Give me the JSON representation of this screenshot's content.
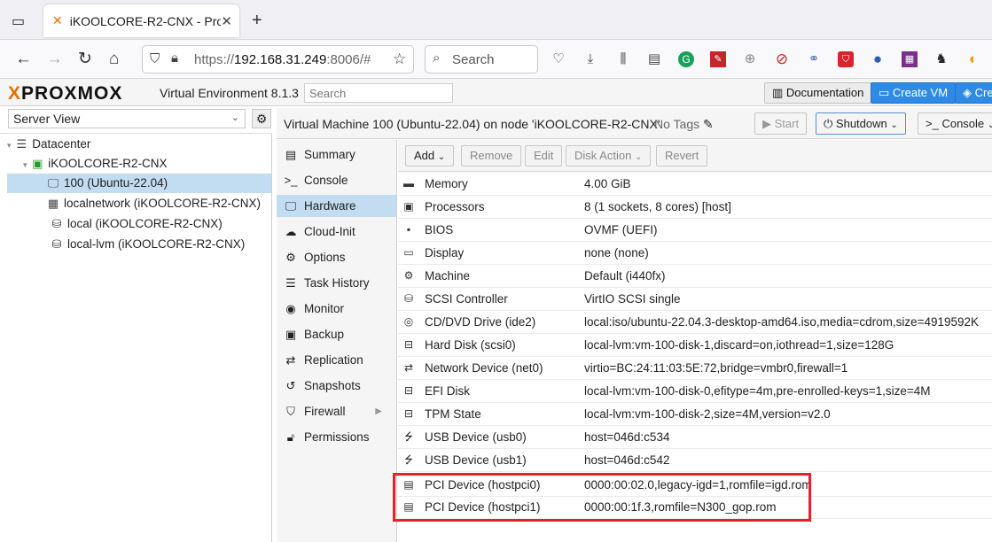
{
  "browser": {
    "tab_title": "iKOOLCORE-R2-CNX - Pro",
    "tab_close": "✕",
    "new_tab": "+",
    "url_scheme": "https://",
    "url_host": "192.168.31.249",
    "url_rest": ":8006/#",
    "search_placeholder": "Search"
  },
  "header": {
    "logo_text": "PROXMOX",
    "version": "Virtual Environment 8.1.3",
    "search_placeholder": "Search",
    "documentation": "Documentation",
    "create_vm": "Create VM",
    "create_ct": "Cre"
  },
  "tree": {
    "view_label": "Server View",
    "items": [
      {
        "label": "Datacenter"
      },
      {
        "label": "iKOOLCORE-R2-CNX"
      },
      {
        "label": "100 (Ubuntu-22.04)"
      },
      {
        "label": "localnetwork (iKOOLCORE-R2-CNX)"
      },
      {
        "label": "local (iKOOLCORE-R2-CNX)"
      },
      {
        "label": "local-lvm (iKOOLCORE-R2-CNX)"
      }
    ]
  },
  "vm": {
    "title": "Virtual Machine 100 (Ubuntu-22.04) on node 'iKOOLCORE-R2-CNX'",
    "tags": "No Tags",
    "start": "Start",
    "shutdown": "Shutdown",
    "console": "Console"
  },
  "menu": [
    {
      "label": "Summary"
    },
    {
      "label": "Console"
    },
    {
      "label": "Hardware"
    },
    {
      "label": "Cloud-Init"
    },
    {
      "label": "Options"
    },
    {
      "label": "Task History"
    },
    {
      "label": "Monitor"
    },
    {
      "label": "Backup"
    },
    {
      "label": "Replication"
    },
    {
      "label": "Snapshots"
    },
    {
      "label": "Firewall"
    },
    {
      "label": "Permissions"
    }
  ],
  "toolbar": {
    "add": "Add",
    "remove": "Remove",
    "edit": "Edit",
    "disk_action": "Disk Action",
    "revert": "Revert"
  },
  "hardware": [
    {
      "name": "Memory",
      "value": "4.00 GiB"
    },
    {
      "name": "Processors",
      "value": "8 (1 sockets, 8 cores) [host]"
    },
    {
      "name": "BIOS",
      "value": "OVMF (UEFI)"
    },
    {
      "name": "Display",
      "value": "none (none)"
    },
    {
      "name": "Machine",
      "value": "Default (i440fx)"
    },
    {
      "name": "SCSI Controller",
      "value": "VirtIO SCSI single"
    },
    {
      "name": "CD/DVD Drive (ide2)",
      "value": "local:iso/ubuntu-22.04.3-desktop-amd64.iso,media=cdrom,size=4919592K"
    },
    {
      "name": "Hard Disk (scsi0)",
      "value": "local-lvm:vm-100-disk-1,discard=on,iothread=1,size=128G"
    },
    {
      "name": "Network Device (net0)",
      "value": "virtio=BC:24:11:03:5E:72,bridge=vmbr0,firewall=1"
    },
    {
      "name": "EFI Disk",
      "value": "local-lvm:vm-100-disk-0,efitype=4m,pre-enrolled-keys=1,size=4M"
    },
    {
      "name": "TPM State",
      "value": "local-lvm:vm-100-disk-2,size=4M,version=v2.0"
    },
    {
      "name": "USB Device (usb0)",
      "value": "host=046d:c534"
    },
    {
      "name": "USB Device (usb1)",
      "value": "host=046d:c542"
    },
    {
      "name": "PCI Device (hostpci0)",
      "value": "0000:00:02.0,legacy-igd=1,romfile=igd.rom"
    },
    {
      "name": "PCI Device (hostpci1)",
      "value": "0000:00:1f.3,romfile=N300_gop.rom"
    }
  ],
  "colors": {
    "accent": "#2d8be6",
    "selection": "#c2ddf2",
    "highlight": "#e8202a",
    "logo_x": "#e57000"
  }
}
